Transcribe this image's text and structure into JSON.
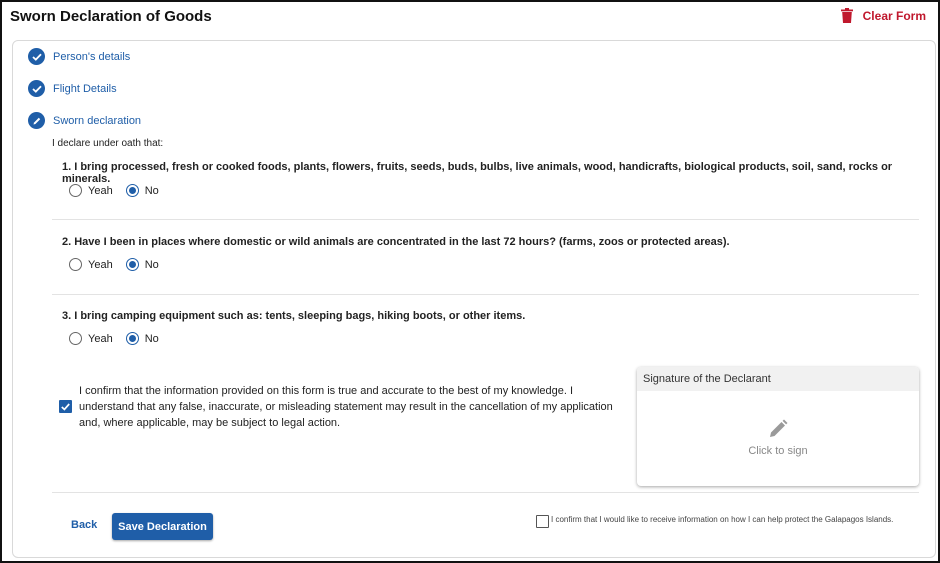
{
  "header": {
    "title": "Sworn Declaration of Goods",
    "clear_label": "Clear Form"
  },
  "steps": [
    {
      "label": "Person's details",
      "state": "done"
    },
    {
      "label": "Flight Details",
      "state": "done"
    },
    {
      "label": "Sworn declaration",
      "state": "active"
    }
  ],
  "declaration": {
    "intro": "I declare under oath that:",
    "questions": [
      {
        "text": "1. I bring processed, fresh or cooked foods, plants, flowers, fruits, seeds, buds, bulbs, live animals, wood, handicrafts, biological products, soil, sand, rocks or minerals.",
        "yes_label": "Yeah",
        "no_label": "No",
        "selected": "No"
      },
      {
        "text": "2. Have I been in places where domestic or wild animals are concentrated in the last 72 hours? (farms, zoos or protected areas).",
        "yes_label": "Yeah",
        "no_label": "No",
        "selected": "No"
      },
      {
        "text": "3. I bring camping equipment such as: tents, sleeping bags, hiking boots, or other items.",
        "yes_label": "Yeah",
        "no_label": "No",
        "selected": "No"
      }
    ]
  },
  "confirm": {
    "text": "I confirm that the information provided on this form is true and accurate to the best of my knowledge. I understand that any false, inaccurate, or misleading statement may result in the cancellation of my application and, where applicable, may be subject to legal action.",
    "checked": true
  },
  "signature": {
    "title": "Signature of the Declarant",
    "hint": "Click to sign"
  },
  "footer": {
    "back_label": "Back",
    "save_label": "Save Declaration",
    "galapagos_text": "I confirm that I would like to receive information on how I can help protect the Galapagos Islands.",
    "galapagos_checked": false
  },
  "colors": {
    "primary": "#1f5ea8",
    "danger": "#c0182d"
  }
}
